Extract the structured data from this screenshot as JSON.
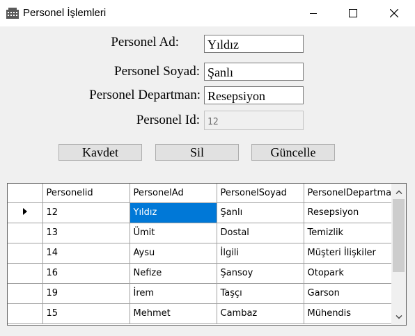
{
  "window": {
    "title": "Personel İşlemleri"
  },
  "form": {
    "ad_label": "Personel Ad:",
    "ad_value": "Yıldız",
    "soyad_label": "Personel Soyad:",
    "soyad_value": "Şanlı",
    "departman_label": "Personel Departman:",
    "departman_value": "Resepsiyon",
    "id_label": "Personel Id:",
    "id_value": "12"
  },
  "buttons": {
    "save": "Kavdet",
    "delete": "Sil",
    "update": "Güncelle"
  },
  "grid": {
    "columns": [
      "Personelid",
      "PersonelAd",
      "PersonelSoyad",
      "PersonelDepartman"
    ],
    "rows": [
      [
        "12",
        "Yıldız",
        "Şanlı",
        "Resepsiyon"
      ],
      [
        "13",
        "Ümit",
        "Dostal",
        "Temizlik"
      ],
      [
        "14",
        "Aysu",
        "İlgili",
        "Müşteri İlişkiler"
      ],
      [
        "16",
        "Nefize",
        "Şansoy",
        "Otopark"
      ],
      [
        "19",
        "İrem",
        "Taşçı",
        "Garson"
      ],
      [
        "15",
        "Mehmet",
        "Cambaz",
        "Mühendis"
      ]
    ],
    "selected_cell": {
      "row": 0,
      "col": 1
    },
    "selection_color": "#0078d7"
  },
  "icons": {
    "app": "building-icon",
    "current_row": "row-pointer-icon"
  }
}
